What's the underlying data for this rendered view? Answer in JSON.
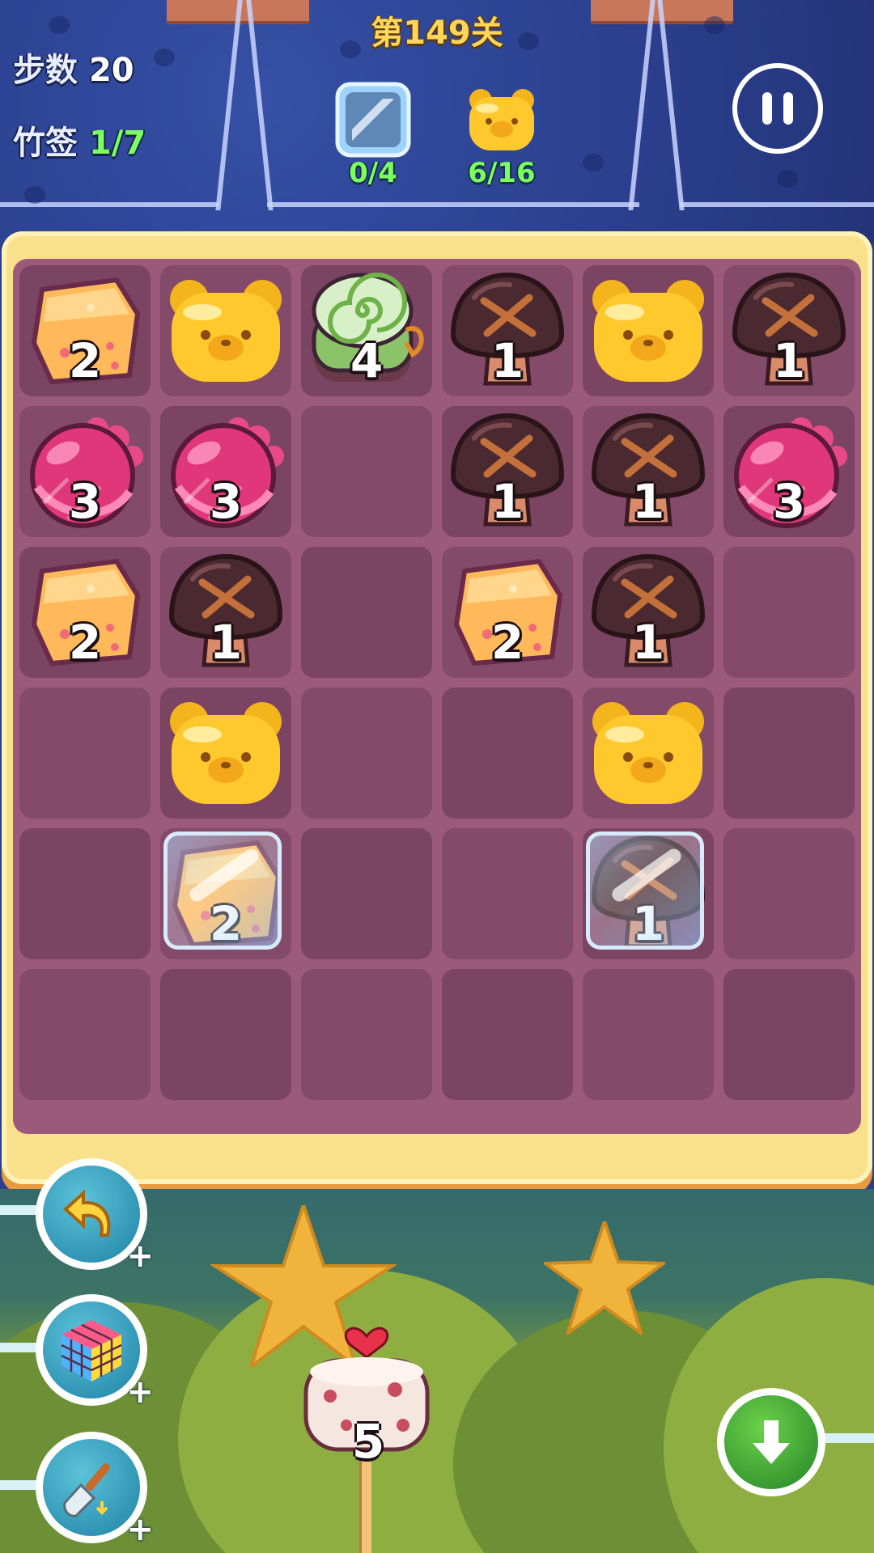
{
  "header": {
    "level_title": "第149关",
    "moves_label": "步数",
    "moves_value": "20",
    "skewers_label": "竹签",
    "skewers_value": "1/7",
    "goals": [
      {
        "icon": "ice-block-icon",
        "count": "0/4"
      },
      {
        "icon": "gummy-bear-icon",
        "count": "6/16"
      }
    ]
  },
  "board": {
    "rows": 6,
    "cols": 6,
    "grid": [
      [
        {
          "type": "tofu",
          "n": "2"
        },
        {
          "type": "bear",
          "n": ""
        },
        {
          "type": "roll",
          "n": "4"
        },
        {
          "type": "mushroom",
          "n": "1"
        },
        {
          "type": "bear",
          "n": ""
        },
        {
          "type": "mushroom",
          "n": "1"
        }
      ],
      [
        {
          "type": "meatball",
          "n": "3"
        },
        {
          "type": "meatball",
          "n": "3"
        },
        {
          "type": "empty",
          "n": ""
        },
        {
          "type": "mushroom",
          "n": "1"
        },
        {
          "type": "mushroom",
          "n": "1"
        },
        {
          "type": "meatball",
          "n": "3"
        }
      ],
      [
        {
          "type": "tofu",
          "n": "2"
        },
        {
          "type": "mushroom",
          "n": "1"
        },
        {
          "type": "empty",
          "n": ""
        },
        {
          "type": "tofu",
          "n": "2"
        },
        {
          "type": "mushroom",
          "n": "1"
        },
        {
          "type": "empty",
          "n": ""
        }
      ],
      [
        {
          "type": "empty",
          "n": ""
        },
        {
          "type": "bear",
          "n": ""
        },
        {
          "type": "empty",
          "n": ""
        },
        {
          "type": "empty",
          "n": ""
        },
        {
          "type": "bear",
          "n": ""
        },
        {
          "type": "empty",
          "n": ""
        }
      ],
      [
        {
          "type": "empty",
          "n": ""
        },
        {
          "type": "tofu",
          "n": "2",
          "ice": true
        },
        {
          "type": "empty",
          "n": ""
        },
        {
          "type": "empty",
          "n": ""
        },
        {
          "type": "mushroom",
          "n": "1",
          "ice": true
        },
        {
          "type": "empty",
          "n": ""
        }
      ],
      [
        {
          "type": "empty",
          "n": ""
        },
        {
          "type": "empty",
          "n": ""
        },
        {
          "type": "empty",
          "n": ""
        },
        {
          "type": "empty",
          "n": ""
        },
        {
          "type": "empty",
          "n": ""
        },
        {
          "type": "empty",
          "n": ""
        }
      ]
    ]
  },
  "tools": [
    {
      "icon": "undo-arrow-icon",
      "plus": "+"
    },
    {
      "icon": "rubiks-cube-icon",
      "plus": "+"
    },
    {
      "icon": "shovel-icon",
      "plus": "+"
    }
  ],
  "skewer": {
    "icon": "fishcake-skewer-icon",
    "count": "5"
  },
  "colors": {
    "board": "#9b5a7a",
    "cell": "#7a4462",
    "frame": "#f9e08a",
    "accent_green": "#7cff5e",
    "title_yellow": "#ffd65a"
  }
}
